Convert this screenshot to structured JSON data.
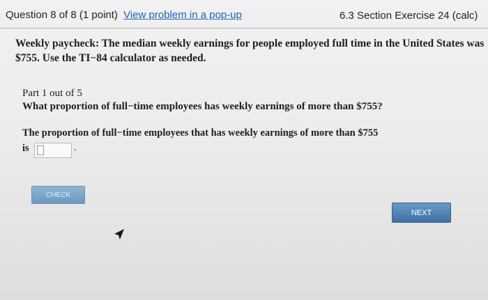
{
  "header": {
    "question_count": "Question 8 of 8 (1 point)",
    "popup_link": "View problem in a pop-up",
    "section": "6.3 Section Exercise 24 (calc)"
  },
  "problem": {
    "title": "Weekly paycheck:",
    "text": "The median weekly earnings for people employed full time in the United States was $755. Use the TI−84 calculator as needed."
  },
  "part": {
    "label": "Part 1 out of 5",
    "question": "What proportion of full−time employees has weekly earnings of more than $755?"
  },
  "answer": {
    "prompt": "The proportion of full−time employees that has weekly earnings of more than $755",
    "is_label": "is",
    "period": ".",
    "value": ""
  },
  "buttons": {
    "check": "CHECK",
    "next": "NEXT"
  }
}
